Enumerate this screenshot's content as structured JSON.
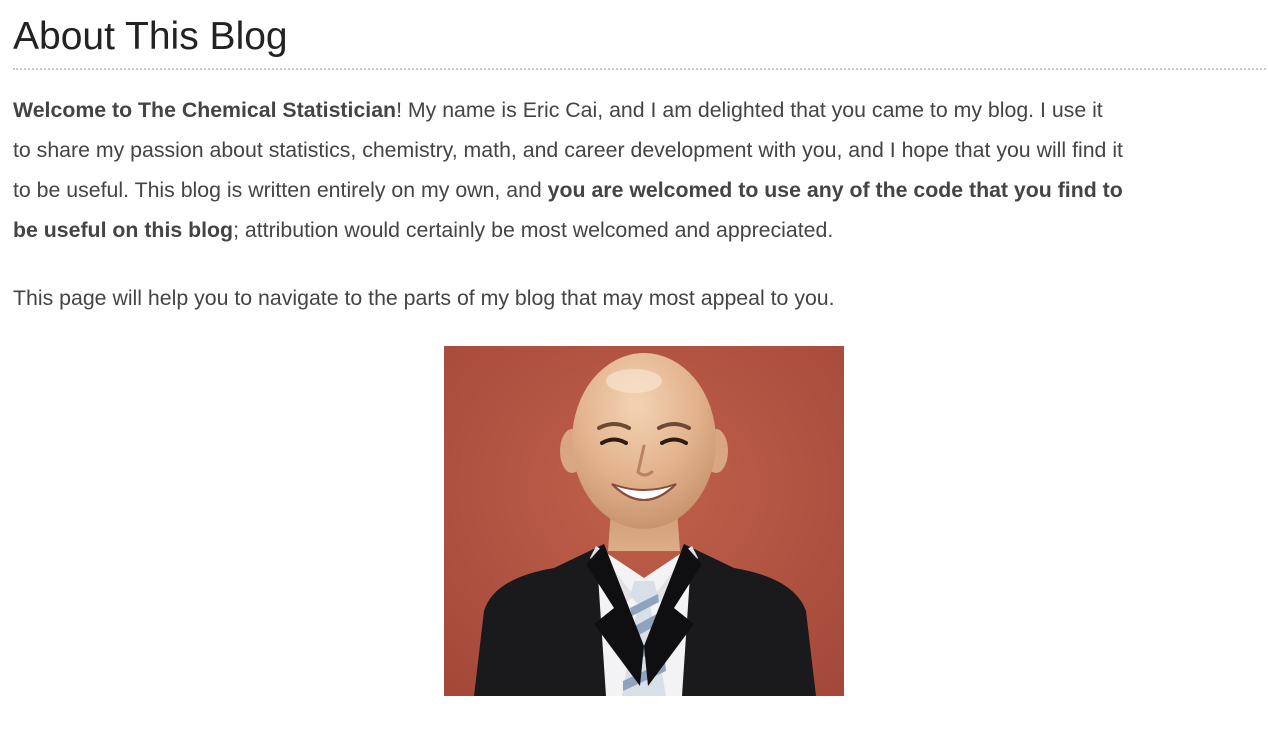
{
  "page": {
    "title": "About This Blog"
  },
  "intro": {
    "line1_bold": "Welcome to The Chemical Statistician",
    "line1_rest": "!  My name is Eric Cai, and I am delighted that you came to my blog.  I use it",
    "line2": "to share my passion about statistics, chemistry, math, and career development with you, and I hope that you will find it",
    "line3_plain": "to be useful.  This blog is written entirely on my own, and ",
    "line3_bold": "you are welcomed to use any of the code that you find to",
    "line4_bold": "be useful on this blog",
    "line4_rest": "; attribution would certainly be most welcomed and appreciated."
  },
  "navigation_note": "This page will help you to navigate to the parts of my blog that may most appeal to you.",
  "portrait": {
    "description_icon": "author-portrait",
    "colors": {
      "background": "#b5523f",
      "skin": "#e3b48f",
      "suit": "#1a1a1c",
      "shirt": "#f2f2f4",
      "tie_stripe": "#8fa3bf"
    }
  }
}
